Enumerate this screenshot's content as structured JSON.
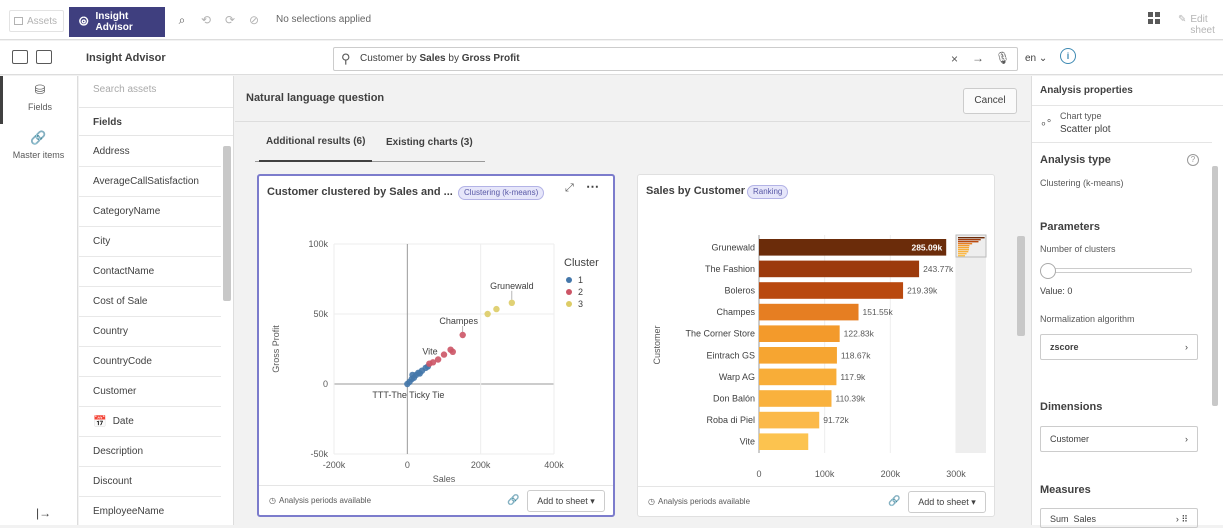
{
  "topbar": {
    "assets_label": "Assets",
    "insight_label": "Insight Advisor",
    "no_selections": "No selections applied",
    "edit_sheet": "Edit sheet"
  },
  "toolbar": {
    "title": "Insight Advisor",
    "query_prefix": "Customer by ",
    "query_sales": "Sales",
    "query_mid": " by ",
    "query_gp": "Gross Profit",
    "lang": "en"
  },
  "nav": {
    "fields": "Fields",
    "master": "Master items"
  },
  "fields": {
    "search_placeholder": "Search assets",
    "header": "Fields",
    "items": [
      "Address",
      "AverageCallSatisfaction",
      "CategoryName",
      "City",
      "ContactName",
      "Cost of Sale",
      "Country",
      "CountryCode",
      "Customer",
      "Date",
      "Description",
      "Discount",
      "EmployeeName"
    ]
  },
  "main": {
    "nlq_label": "Natural language question",
    "cancel": "Cancel",
    "tabs": [
      "Additional results (6)",
      "Existing charts (3)"
    ]
  },
  "card1": {
    "title": "Customer clustered by Sales and ...",
    "badge": "Clustering (k-means)",
    "footer": "Analysis periods available",
    "add": "Add to sheet"
  },
  "card2": {
    "title": "Sales by Customer",
    "badge": "Ranking",
    "footer": "Analysis periods available",
    "add": "Add to sheet"
  },
  "right": {
    "analysis_properties": "Analysis properties",
    "chart_type_label": "Chart type",
    "chart_type": "Scatter plot",
    "analysis_type_h": "Analysis type",
    "analysis_type": "Clustering (k-means)",
    "parameters_h": "Parameters",
    "num_clusters": "Number of clusters",
    "value": "Value: 0",
    "norm_algo": "Normalization algorithm",
    "zscore": "zscore",
    "dimensions_h": "Dimensions",
    "dimension": "Customer",
    "measures_h": "Measures",
    "measure_agg": "Sum",
    "measure": "Sales"
  },
  "colors": {
    "accent": "#3f3f7f",
    "cluster1": "#4477aa",
    "cluster2": "#cc5566",
    "cluster3": "#ddcc66"
  },
  "chart_data": [
    {
      "type": "scatter",
      "title": "Customer clustered by Sales and ...",
      "xlabel": "Sales",
      "ylabel": "Gross Profit",
      "xlim": [
        -200000,
        400000
      ],
      "ylim": [
        -50000,
        100000
      ],
      "x_ticks": [
        "-200k",
        "0",
        "200k",
        "400k"
      ],
      "y_ticks": [
        "100k",
        "50k",
        "0",
        "-50k"
      ],
      "legend_title": "Cluster",
      "legend_position": "right",
      "series": [
        {
          "name": "1",
          "color": "#4477aa",
          "points": [
            [
              0,
              0
            ],
            [
              6000,
              1500
            ],
            [
              12000,
              3500
            ],
            [
              18000,
              4500
            ],
            [
              24000,
              6500
            ],
            [
              30000,
              8000
            ],
            [
              40000,
              9500
            ],
            [
              50000,
              11500
            ],
            [
              56000,
              12500
            ],
            [
              14000,
              6500
            ],
            [
              34000,
              7500
            ]
          ]
        },
        {
          "name": "2",
          "color": "#cc5566",
          "points": [
            [
              60000,
              14500
            ],
            [
              70000,
              15500
            ],
            [
              84000,
              17500
            ],
            [
              100000,
              21000
            ],
            [
              118000,
              24500
            ],
            [
              124000,
              23000
            ],
            [
              151000,
              35000
            ]
          ]
        },
        {
          "name": "3",
          "color": "#ddcc66",
          "points": [
            [
              219000,
              50000
            ],
            [
              243000,
              53500
            ],
            [
              285000,
              58000
            ]
          ]
        }
      ],
      "labels": [
        {
          "text": "Grunewald",
          "x": 285000,
          "y": 58000
        },
        {
          "text": "Champes",
          "x": 151000,
          "y": 35000
        },
        {
          "text": "Vite",
          "x": 70000,
          "y": 15500
        },
        {
          "text": "TTT-The Ticky Tie",
          "x": 0,
          "y": 0
        }
      ]
    },
    {
      "type": "bar",
      "orientation": "horizontal",
      "title": "Sales by Customer",
      "xlabel": "Sales",
      "ylabel": "Customer",
      "xlim": [
        0,
        300000
      ],
      "x_ticks": [
        "0",
        "100k",
        "200k",
        "300k"
      ],
      "categories": [
        "Grunewald",
        "The Fashion",
        "Boleros",
        "Champes",
        "The Corner Store",
        "Eintrach GS",
        "Warp AG",
        "Don Balón",
        "Roba di Piel",
        "Vite"
      ],
      "values": [
        285090,
        243770,
        219390,
        151550,
        122830,
        118670,
        117900,
        110390,
        91720,
        75000
      ],
      "value_labels": [
        "285.09k",
        "243.77k",
        "219.39k",
        "151.55k",
        "122.83k",
        "118.67k",
        "117.9k",
        "110.39k",
        "91.72k",
        ""
      ],
      "colors": [
        "#6b2c0a",
        "#9c3a0c",
        "#b9490f",
        "#e67e22",
        "#f39a2b",
        "#f6a531",
        "#f8ad38",
        "#f9b13d",
        "#fbb94a",
        "#fcc34f"
      ]
    }
  ]
}
